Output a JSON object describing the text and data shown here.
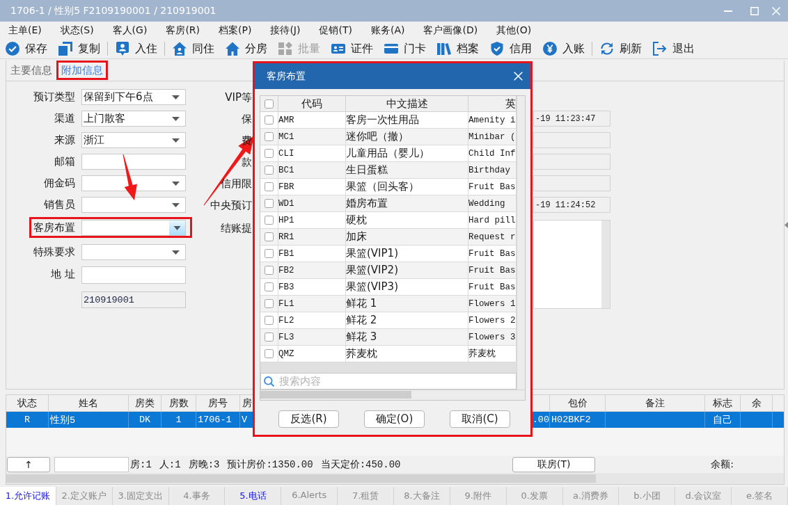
{
  "window": {
    "title": "1706-1 / 性别5 F2109190001 / 210919001"
  },
  "menu": [
    "主单(E)",
    "状态(S)",
    "客人(G)",
    "客房(R)",
    "档案(P)",
    "接待(J)",
    "促销(T)",
    "账务(A)",
    "客户画像(D)",
    "其他(O)"
  ],
  "toolbar": [
    {
      "kind": "save",
      "label": "保存",
      "disabled": false,
      "separator_after": false
    },
    {
      "kind": "copy",
      "label": "复制",
      "disabled": false,
      "separator_after": true
    },
    {
      "kind": "checkin",
      "label": "入住",
      "disabled": false,
      "separator_after": true
    },
    {
      "kind": "share",
      "label": "同住",
      "disabled": false,
      "separator_after": false
    },
    {
      "kind": "assign",
      "label": "分房",
      "disabled": false,
      "separator_after": false
    },
    {
      "kind": "batch",
      "label": "批量",
      "disabled": true,
      "separator_after": false
    },
    {
      "kind": "id",
      "label": "证件",
      "disabled": false,
      "separator_after": false
    },
    {
      "kind": "card",
      "label": "门卡",
      "disabled": false,
      "separator_after": false
    },
    {
      "kind": "profile",
      "label": "档案",
      "disabled": false,
      "separator_after": false
    },
    {
      "kind": "credit",
      "label": "信用",
      "disabled": false,
      "separator_after": false
    },
    {
      "kind": "post",
      "label": "入账",
      "disabled": false,
      "separator_after": true
    },
    {
      "kind": "refresh",
      "label": "刷新",
      "disabled": false,
      "separator_after": false
    },
    {
      "kind": "exit",
      "label": "退出",
      "disabled": false,
      "separator_after": false
    }
  ],
  "form": {
    "tabs": [
      {
        "label": "主要信息",
        "selected": false
      },
      {
        "label": "附加信息",
        "selected": true
      }
    ],
    "left_fields": [
      {
        "label": "预订类型",
        "kind": "dropdown",
        "value": "保留到下午6点",
        "focused": false
      },
      {
        "label": "渠道",
        "kind": "dropdown",
        "value": "上门散客",
        "focused": false
      },
      {
        "label": "来源",
        "kind": "dropdown",
        "value": "浙江",
        "focused": false
      },
      {
        "label": "邮箱",
        "kind": "text",
        "focused": false
      },
      {
        "label": "佣金码",
        "kind": "dropdown",
        "focused": false
      },
      {
        "label": "销售员",
        "kind": "dropdown",
        "focused": false
      },
      {
        "label": "客房布置",
        "kind": "dropdown",
        "focused": true
      },
      {
        "label": "特殊要求",
        "kind": "dropdown",
        "focused": false
      },
      {
        "label": "地 址",
        "kind": "text",
        "focused": false
      },
      {
        "kind": "readonly",
        "value": "210919001",
        "focused": false
      }
    ],
    "middle_labels": [
      "VIP等",
      "保",
      "费",
      "款",
      "信用限",
      "中央预订",
      "结账提"
    ],
    "right_fields": [
      {
        "kind": "readonly",
        "value": "-19 11:23:47"
      },
      {
        "kind": "readonly"
      },
      {
        "kind": "readonly"
      },
      {
        "kind": "readonly"
      },
      {
        "kind": "readonly",
        "value": "-19 11:24:52"
      },
      {
        "kind": "textarea"
      }
    ]
  },
  "room_setup_dialog": {
    "title": "客房布置",
    "all_checked": false,
    "columns": [
      "代码",
      "中文描述",
      "英"
    ],
    "items": [
      {
        "code": "AMR",
        "name_cn": "客房一次性用品",
        "name_en": "Amenity i",
        "checked": false
      },
      {
        "code": "MC1",
        "name_cn": "迷你吧（撤）",
        "name_en": "Minibar (",
        "checked": false
      },
      {
        "code": "CLI",
        "name_cn": "儿童用品（婴儿）",
        "name_en": "Child Inf",
        "checked": false
      },
      {
        "code": "BC1",
        "name_cn": "生日蛋糕",
        "name_en": "Birthday",
        "checked": false
      },
      {
        "code": "FBR",
        "name_cn": "果篮（回头客）",
        "name_en": "Fruit Bas",
        "checked": false
      },
      {
        "code": "WD1",
        "name_cn": "婚房布置",
        "name_en": "Wedding",
        "checked": false
      },
      {
        "code": "HP1",
        "name_cn": "硬枕",
        "name_en": "Hard pill",
        "checked": false
      },
      {
        "code": "RR1",
        "name_cn": "加床",
        "name_en": "Request r",
        "checked": false
      },
      {
        "code": "FB1",
        "name_cn": "果篮(VIP1)",
        "name_en": "Fruit Bas",
        "checked": false
      },
      {
        "code": "FB2",
        "name_cn": "果篮(VIP2)",
        "name_en": "Fruit Bas",
        "checked": false
      },
      {
        "code": "FB3",
        "name_cn": "果篮(VIP3)",
        "name_en": "Fruit Bas",
        "checked": false
      },
      {
        "code": "FL1",
        "name_cn": "鲜花 1",
        "name_en": "Flowers 1",
        "checked": false
      },
      {
        "code": "FL2",
        "name_cn": "鲜花 2",
        "name_en": "Flowers 2",
        "checked": false
      },
      {
        "code": "FL3",
        "name_cn": "鲜花 3",
        "name_en": "Flowers 3",
        "checked": false
      },
      {
        "code": "QMZ",
        "name_cn": "荞麦枕",
        "name_en": "荞麦枕",
        "checked": false
      }
    ],
    "search": {
      "placeholder": "搜索内容"
    },
    "buttons": [
      "反选(R)",
      "确定(O)",
      "取消(C)"
    ]
  },
  "guest_table": {
    "columns": [
      "状态",
      "姓名",
      "房类",
      "房数",
      "房号",
      "房",
      null,
      "包价",
      "备注",
      "标志",
      "余"
    ],
    "rows": [
      {
        "selected": true,
        "cells": [
          "R",
          "性别5",
          "DK",
          "1",
          "1706-1",
          "V",
          ".00",
          "H02BKF2",
          null,
          "自己",
          null
        ]
      }
    ]
  },
  "table_footer": {
    "up_button": "↑",
    "stats": [
      "房:1",
      "人:1",
      "房晚:3",
      "预计房价:1350.00",
      "当天定价:450.00"
    ],
    "link_button": "联房(T)",
    "balance_label": "余额:"
  },
  "bottom_tabs": [
    {
      "label": "1.允许记账",
      "selected": true,
      "highlighted": true
    },
    {
      "label": "2.定义账户",
      "selected": false,
      "highlighted": false
    },
    {
      "label": "3.固定支出",
      "selected": false,
      "highlighted": false
    },
    {
      "label": "4.事务",
      "selected": false,
      "highlighted": false
    },
    {
      "label": "5.电话",
      "selected": false,
      "highlighted": true
    },
    {
      "label": "6.Alerts",
      "selected": false,
      "highlighted": false
    },
    {
      "label": "7.租赁",
      "selected": false,
      "highlighted": false
    },
    {
      "label": "8.大备注",
      "selected": false,
      "highlighted": false
    },
    {
      "label": "9.附件",
      "selected": false,
      "highlighted": false
    },
    {
      "label": "0.发票",
      "selected": false,
      "highlighted": false
    },
    {
      "label": "a.消费券",
      "selected": false,
      "highlighted": false
    },
    {
      "label": "b.小团",
      "selected": false,
      "highlighted": false
    },
    {
      "label": "d.会议室",
      "selected": false,
      "highlighted": false
    },
    {
      "label": "e.签名",
      "selected": false,
      "highlighted": false
    }
  ]
}
